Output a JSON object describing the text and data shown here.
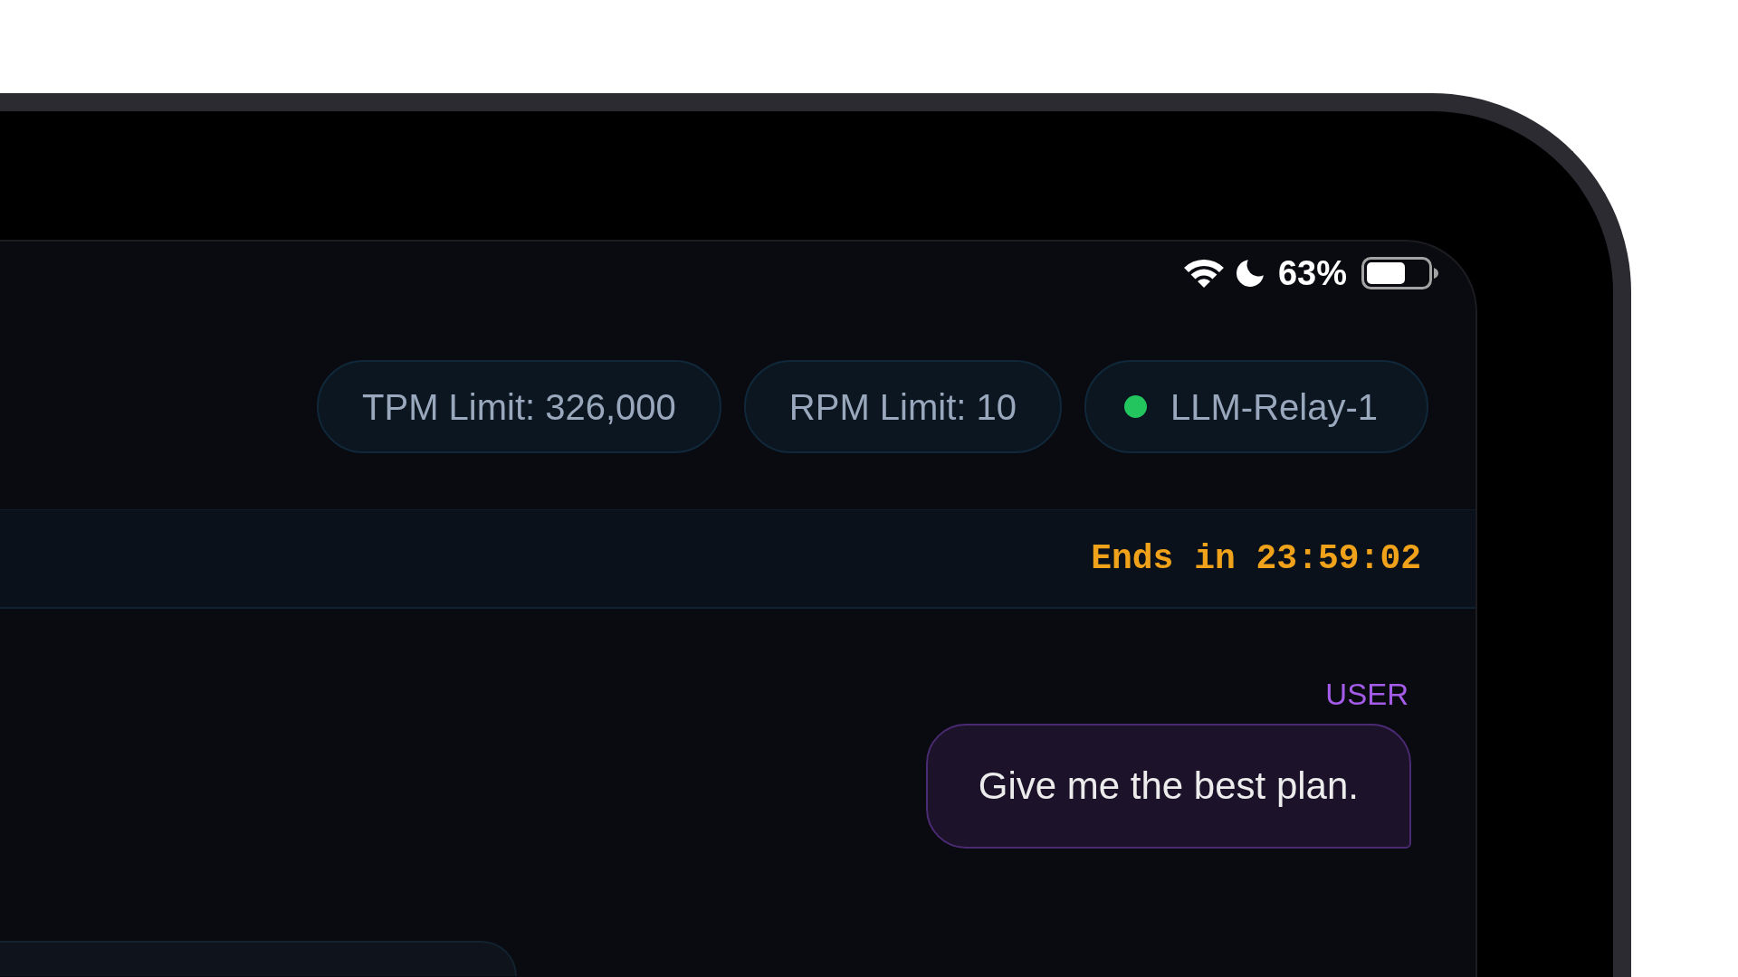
{
  "status_bar": {
    "battery": "63%"
  },
  "badges": [
    {
      "kind": "limit",
      "label": "TPM Limit: 326,000"
    },
    {
      "kind": "limit",
      "label": "RPM Limit: 10"
    },
    {
      "kind": "server",
      "label": "LLM-Relay-1",
      "color": "#22c55e"
    }
  ],
  "timer": {
    "text": "Ends in 23:59:02"
  },
  "messages": [
    {
      "kind": "user",
      "sender": "USER",
      "text": "Give me the best plan."
    },
    {
      "kind": "assistant"
    }
  ]
}
